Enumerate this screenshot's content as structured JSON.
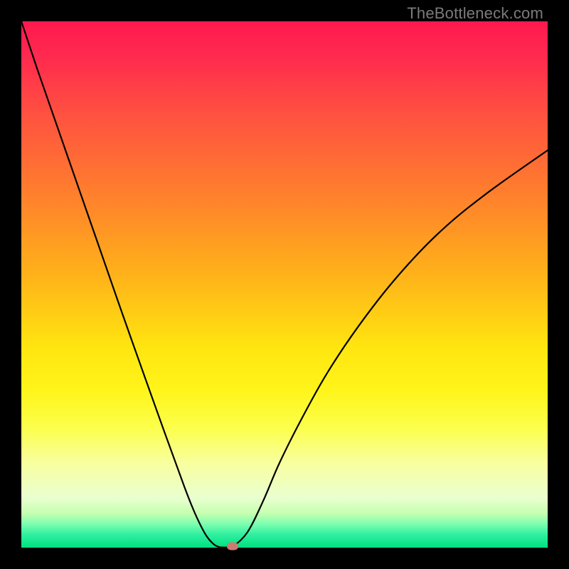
{
  "watermark": "TheBottleneck.com",
  "chart_data": {
    "type": "line",
    "title": "",
    "xlabel": "",
    "ylabel": "",
    "xlim": [
      0,
      100
    ],
    "ylim": [
      0,
      100
    ],
    "grid": false,
    "background_gradient": [
      {
        "stop": 0.0,
        "color": "#ff1a4d"
      },
      {
        "stop": 0.06,
        "color": "#ff2850"
      },
      {
        "stop": 0.18,
        "color": "#ff5340"
      },
      {
        "stop": 0.32,
        "color": "#ff7d2e"
      },
      {
        "stop": 0.48,
        "color": "#ffb21a"
      },
      {
        "stop": 0.62,
        "color": "#ffe610"
      },
      {
        "stop": 0.7,
        "color": "#fff51a"
      },
      {
        "stop": 0.77,
        "color": "#fcff4a"
      },
      {
        "stop": 0.84,
        "color": "#f8ffa0"
      },
      {
        "stop": 0.905,
        "color": "#eaffd0"
      },
      {
        "stop": 0.935,
        "color": "#c6ffb0"
      },
      {
        "stop": 0.955,
        "color": "#7dffb0"
      },
      {
        "stop": 0.975,
        "color": "#30f0a0"
      },
      {
        "stop": 1.0,
        "color": "#00e080"
      }
    ],
    "series": [
      {
        "name": "bottleneck-curve",
        "color": "#000000",
        "x": [
          0,
          3,
          7,
          11,
          15,
          19,
          23,
          27,
          31,
          33,
          35,
          36.5,
          37.5,
          38.3,
          39.0,
          39.6,
          40.2,
          43.0,
          46.0,
          49.0,
          53.0,
          58.0,
          64.0,
          71.0,
          79.0,
          88.0,
          100.0
        ],
        "y": [
          100,
          91,
          79.5,
          68,
          56.5,
          45,
          33.7,
          22.5,
          11.5,
          6.5,
          2.5,
          0.7,
          0.15,
          0.05,
          0.05,
          0.08,
          0.2,
          3.0,
          9.0,
          16.0,
          24.0,
          33.0,
          42.0,
          51.0,
          59.5,
          67.0,
          75.5
        ]
      }
    ],
    "marker": {
      "x": 40.2,
      "y": 0.3,
      "color": "#cf7a6f"
    }
  }
}
